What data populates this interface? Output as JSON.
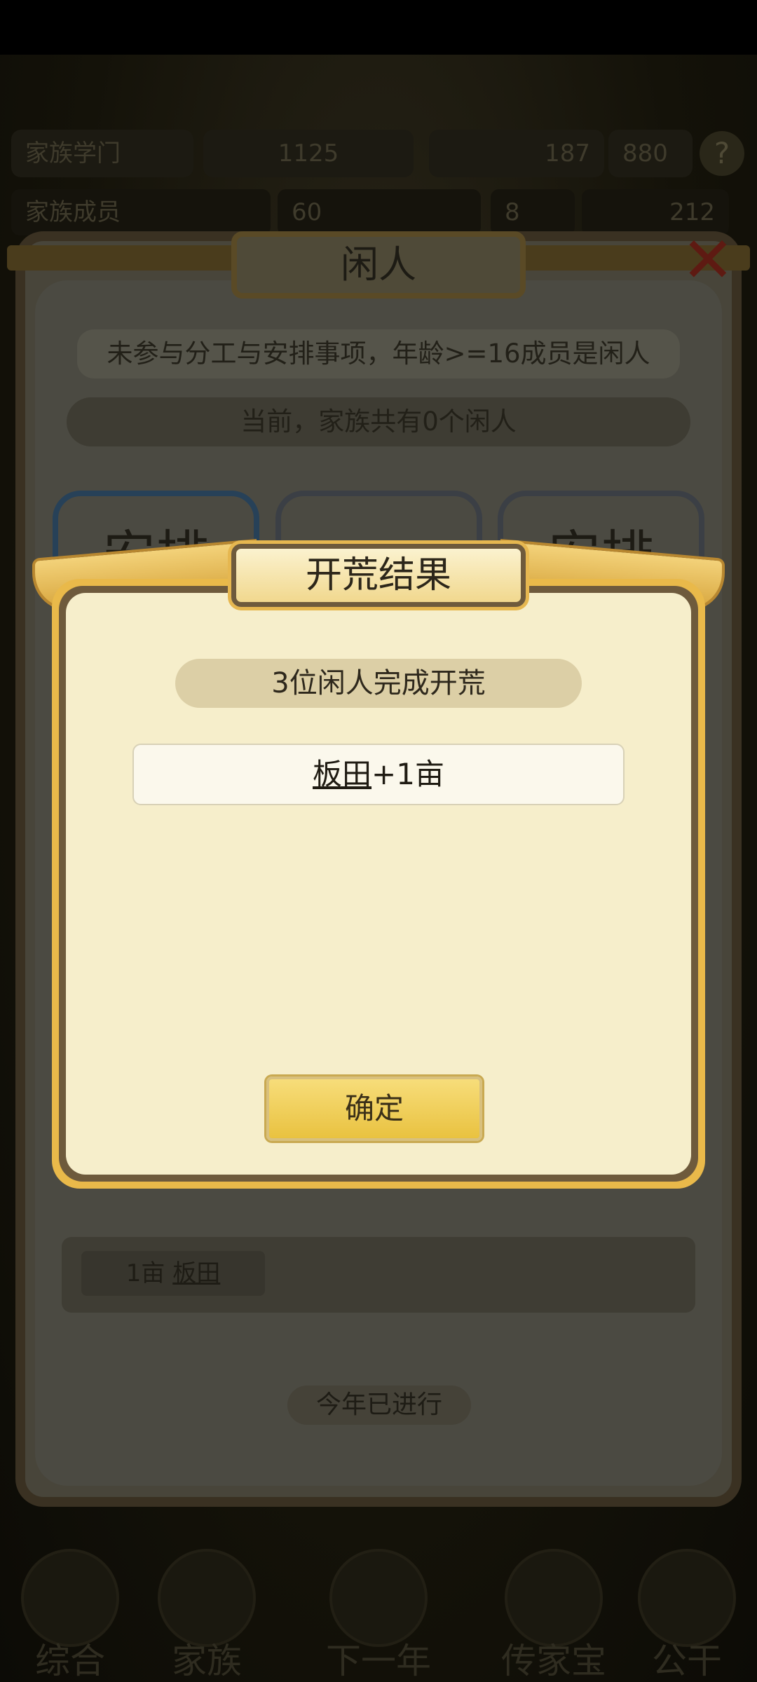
{
  "background": {
    "top_bar": [
      "家族学门",
      "1125",
      "187",
      "880"
    ],
    "stat_row": [
      "家族成员",
      "60",
      "8",
      "212"
    ],
    "panel_title": "闲人",
    "close_glyph": "✕",
    "description": "未参与分工与安排事项，年龄>=16成员是闲人",
    "status": "当前，家族共有0个闲人",
    "cards": [
      "安排",
      "",
      "安排"
    ],
    "list_item": {
      "amount": "1亩",
      "name": "板田"
    },
    "year_status": "今年已进行",
    "nav": [
      "综合",
      "家族",
      "下一年",
      "传家宝",
      "公干"
    ]
  },
  "modal": {
    "title": "开荒结果",
    "result": "3位闲人完成开荒",
    "reward": {
      "name": "板田",
      "amount": "+1亩"
    },
    "confirm_label": "确定"
  },
  "colors": {
    "modal_bg": "#f6eecb",
    "modal_gold": "#e9b94a",
    "button_gold": "#e9c240"
  }
}
